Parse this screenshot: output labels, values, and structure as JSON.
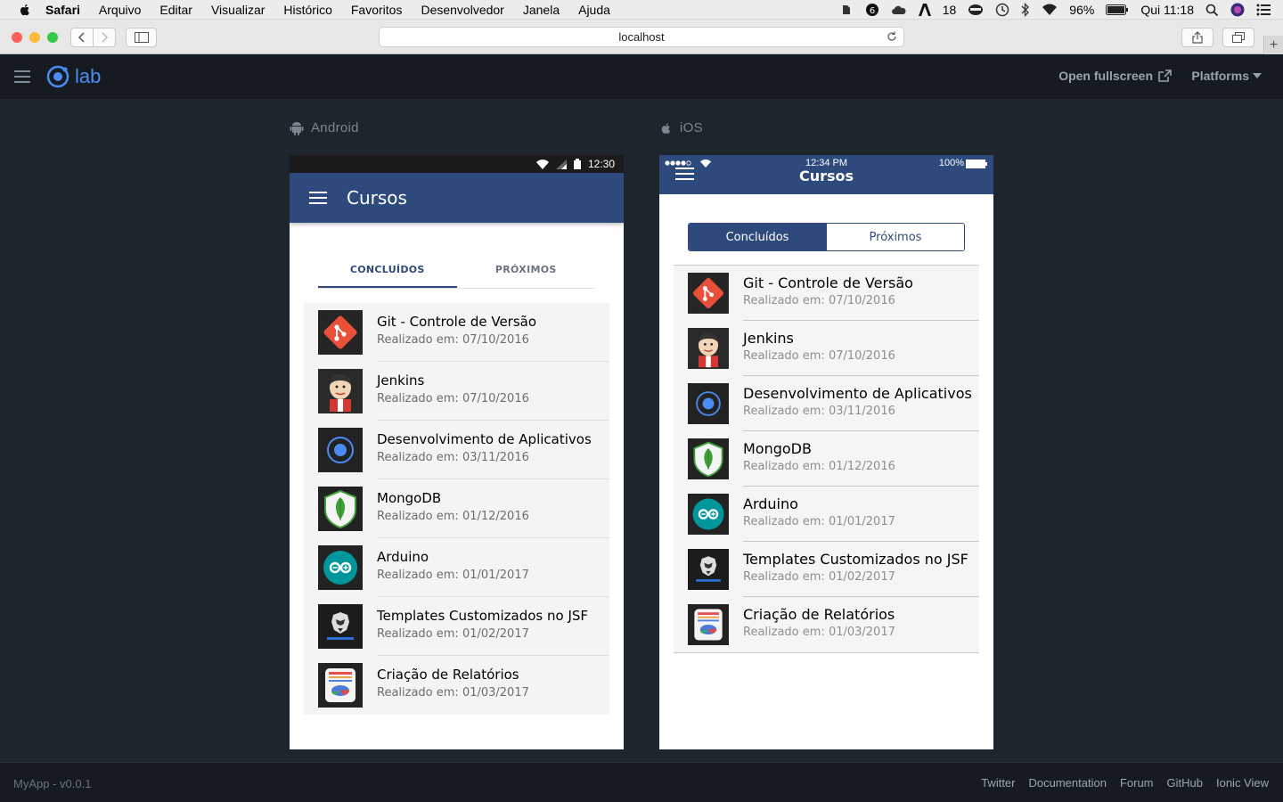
{
  "menubar": {
    "app": "Safari",
    "items": [
      "Arquivo",
      "Editar",
      "Visualizar",
      "Histórico",
      "Favoritos",
      "Desenvolvedor",
      "Janela",
      "Ajuda"
    ],
    "status_number": "18",
    "battery": "96%",
    "clock": "Qui 11:18"
  },
  "browser": {
    "url": "localhost"
  },
  "lab": {
    "logo_text": "lab",
    "open_fullscreen": "Open fullscreen",
    "platforms": "Platforms"
  },
  "android": {
    "label": "Android",
    "status_time": "12:30",
    "title": "Cursos",
    "tabs": [
      "CONCLUÍDOS",
      "PRÓXIMOS"
    ]
  },
  "ios": {
    "label": "iOS",
    "status_time": "12:34 PM",
    "status_battery": "100%",
    "title": "Cursos",
    "segments": [
      "Concluídos",
      "Próximos"
    ]
  },
  "courses": [
    {
      "title": "Git - Controle de Versão",
      "date": "Realizado em: 07/10/2016",
      "icon": "git-icon"
    },
    {
      "title": "Jenkins",
      "date": "Realizado em: 07/10/2016",
      "icon": "jenkins-icon"
    },
    {
      "title": "Desenvolvimento de Aplicativos",
      "date": "Realizado em: 03/11/2016",
      "icon": "ionic-icon"
    },
    {
      "title": "MongoDB",
      "date": "Realizado em: 01/12/2016",
      "icon": "mongodb-icon"
    },
    {
      "title": "Arduino",
      "date": "Realizado em: 01/01/2017",
      "icon": "arduino-icon"
    },
    {
      "title": "Templates Customizados no JSF",
      "date": "Realizado em: 01/02/2017",
      "icon": "primefaces-icon"
    },
    {
      "title": "Criação de Relatórios",
      "date": "Realizado em: 01/03/2017",
      "icon": "reports-icon"
    }
  ],
  "footer": {
    "version": "MyApp - v0.0.1",
    "links": [
      "Twitter",
      "Documentation",
      "Forum",
      "GitHub",
      "Ionic View"
    ]
  },
  "colors": {
    "primary": "#2e4a7d",
    "ionic_blue": "#4b8bf4"
  }
}
